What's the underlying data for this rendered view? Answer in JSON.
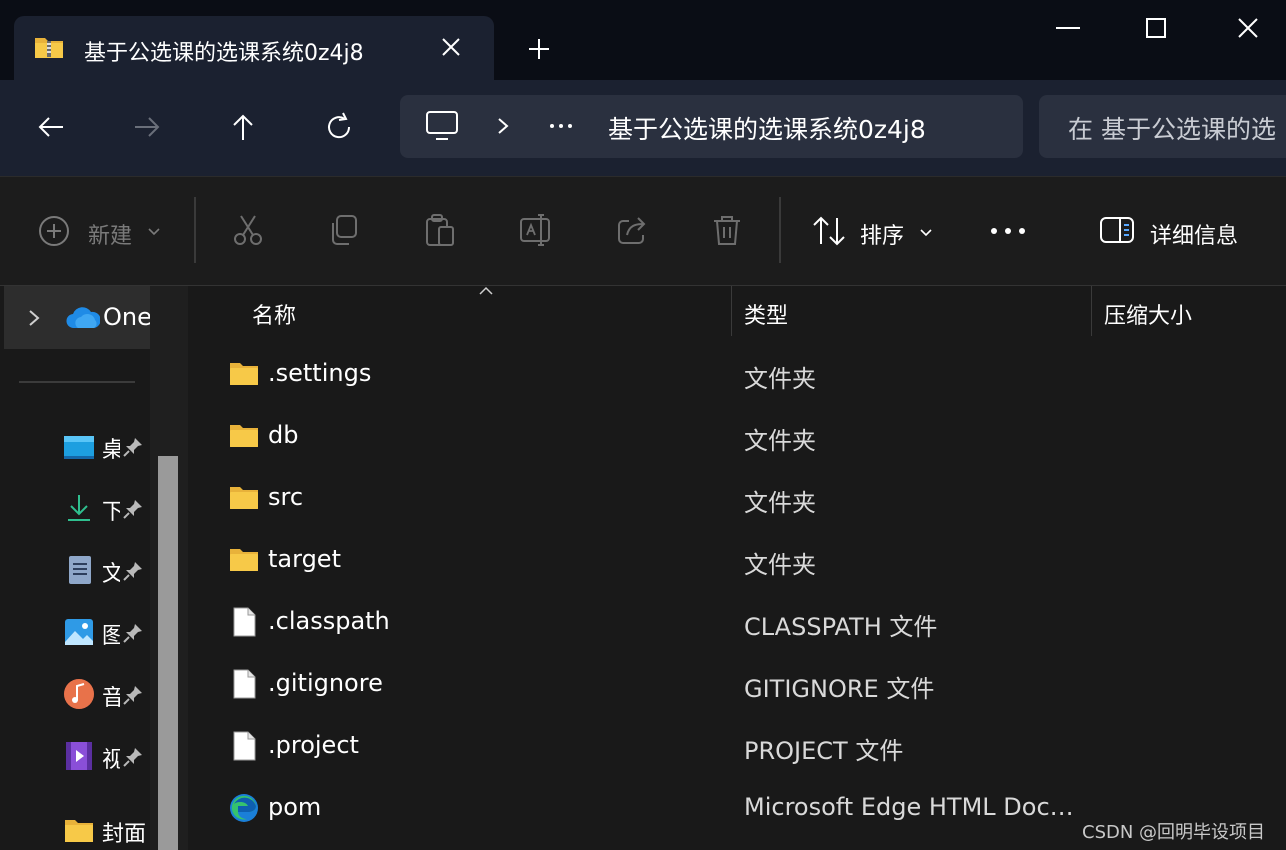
{
  "window": {
    "tab_title": "基于公选课的选课系统0z4j8",
    "tab_icon": "zip-folder-icon",
    "controls": [
      "minimize-icon",
      "maximize-icon",
      "close-icon"
    ]
  },
  "address_bar": {
    "path_current": "基于公选课的选课系统0z4j8",
    "search_text": "在 基于公选课的选"
  },
  "toolbar": {
    "new_label": "新建",
    "sort_label": "排序",
    "details_label": "详细信息"
  },
  "nav_pane": {
    "onedrive_label": "One",
    "quick_access": [
      {
        "label": "桌",
        "icon": "desktop-icon"
      },
      {
        "label": "下",
        "icon": "download-icon"
      },
      {
        "label": "文",
        "icon": "documents-icon"
      },
      {
        "label": "图",
        "icon": "pictures-icon"
      },
      {
        "label": "音",
        "icon": "music-icon"
      },
      {
        "label": "视",
        "icon": "videos-icon"
      },
      {
        "label": "封面",
        "icon": "folder-icon"
      }
    ]
  },
  "columns": {
    "name": "名称",
    "type": "类型",
    "size": "压缩大小"
  },
  "files": [
    {
      "name": ".settings",
      "type": "文件夹",
      "icon": "folder-icon"
    },
    {
      "name": "db",
      "type": "文件夹",
      "icon": "folder-icon"
    },
    {
      "name": "src",
      "type": "文件夹",
      "icon": "folder-icon"
    },
    {
      "name": "target",
      "type": "文件夹",
      "icon": "folder-icon"
    },
    {
      "name": ".classpath",
      "type": "CLASSPATH 文件",
      "icon": "file-icon"
    },
    {
      "name": ".gitignore",
      "type": "GITIGNORE 文件",
      "icon": "file-icon"
    },
    {
      "name": ".project",
      "type": "PROJECT 文件",
      "icon": "file-icon"
    },
    {
      "name": "pom",
      "type": "Microsoft Edge HTML Docu...",
      "icon": "edge-icon"
    }
  ],
  "watermark": "CSDN @回明毕设项目",
  "colors": {
    "titlebar": "#0a0d15",
    "navbar": "#1b2130",
    "toolbar": "#1c1c1c",
    "content": "#191919",
    "folder": "#f7c948"
  }
}
